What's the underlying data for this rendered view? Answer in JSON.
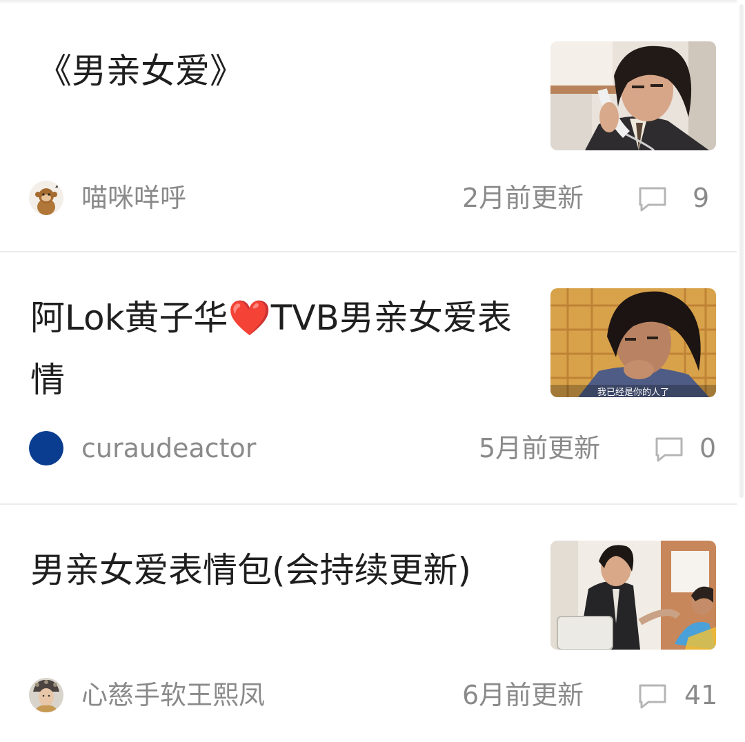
{
  "articles": [
    {
      "title": "《男亲女爱》",
      "author": "喵咪咩呼",
      "updated": "2月前更新",
      "comments": "9",
      "avatar_icon": "monkey-avatar-icon",
      "thumbnail": "man-on-phone-thumbnail"
    },
    {
      "title": "阿Lok黄子华❤️TVB男亲女爱表情",
      "author": "curaudeactor",
      "updated": "5月前更新",
      "comments": "0",
      "avatar_icon": "blue-circle-avatar-icon",
      "avatar_color": "#0a3d8f",
      "thumbnail": "man-thinking-thumbnail",
      "thumbnail_caption": "我已经是你的人了"
    },
    {
      "title": "男亲女爱表情包(会持续更新)",
      "author": "心慈手软王熙凤",
      "updated": "6月前更新",
      "comments": "41",
      "avatar_icon": "woman-headdress-avatar-icon",
      "thumbnail": "office-scene-thumbnail"
    }
  ],
  "colors": {
    "title_text": "#1f1f1f",
    "meta_text": "#8a8a8a",
    "divider": "#ececec",
    "comment_icon": "#b5b5b5"
  },
  "icons": {
    "comment": "comment-icon"
  }
}
